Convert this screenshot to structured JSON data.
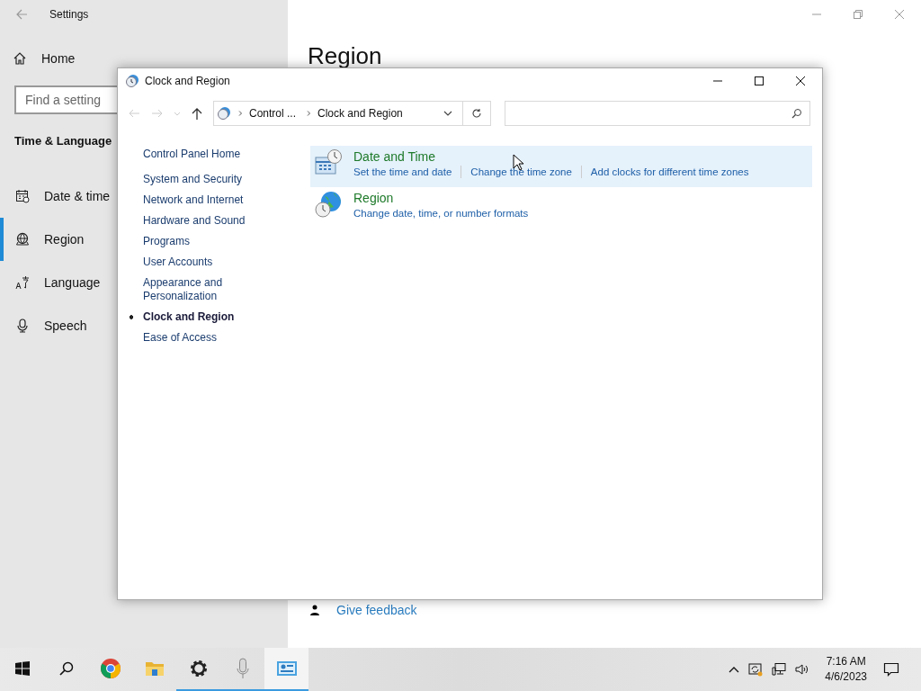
{
  "settings": {
    "title": "Settings",
    "home": "Home",
    "search": {
      "placeholder": "Find a setting"
    },
    "section": "Time & Language",
    "items": [
      {
        "kind": "date",
        "label": "Date & time",
        "selected": false
      },
      {
        "kind": "region",
        "label": "Region",
        "selected": true
      },
      {
        "kind": "language",
        "label": "Language",
        "selected": false
      },
      {
        "kind": "speech",
        "label": "Speech",
        "selected": false
      }
    ],
    "page_title": "Region",
    "feedback": "Give feedback"
  },
  "control_panel": {
    "title": "Clock and Region",
    "breadcrumb": [
      "Control ...",
      "Clock and Region"
    ],
    "sidebar": {
      "home": "Control Panel Home",
      "items": [
        {
          "label": "System and Security",
          "selected": false
        },
        {
          "label": "Network and Internet",
          "selected": false
        },
        {
          "label": "Hardware and Sound",
          "selected": false
        },
        {
          "label": "Programs",
          "selected": false
        },
        {
          "label": "User Accounts",
          "selected": false
        },
        {
          "label": "Appearance and Personalization",
          "selected": false
        },
        {
          "label": "Clock and Region",
          "selected": true
        },
        {
          "label": "Ease of Access",
          "selected": false
        }
      ]
    },
    "categories": [
      {
        "kind": "clock",
        "title": "Date and Time",
        "highlighted": true,
        "links": [
          "Set the time and date",
          "Change the time zone",
          "Add clocks for different time zones"
        ]
      },
      {
        "kind": "globe",
        "title": "Region",
        "highlighted": false,
        "links": [
          "Change date, time, or number formats"
        ]
      }
    ]
  },
  "taskbar": {
    "apps": [
      {
        "kind": "start",
        "running": false,
        "selected": false
      },
      {
        "kind": "search",
        "running": false,
        "selected": false
      },
      {
        "kind": "chrome",
        "running": false,
        "selected": false
      },
      {
        "kind": "explorer",
        "running": false,
        "selected": false
      },
      {
        "kind": "settings",
        "running": true,
        "selected": false
      },
      {
        "kind": "mic",
        "running": true,
        "selected": false
      },
      {
        "kind": "control",
        "running": true,
        "selected": true
      }
    ],
    "time": "7:16 AM",
    "date": "4/6/2023"
  }
}
